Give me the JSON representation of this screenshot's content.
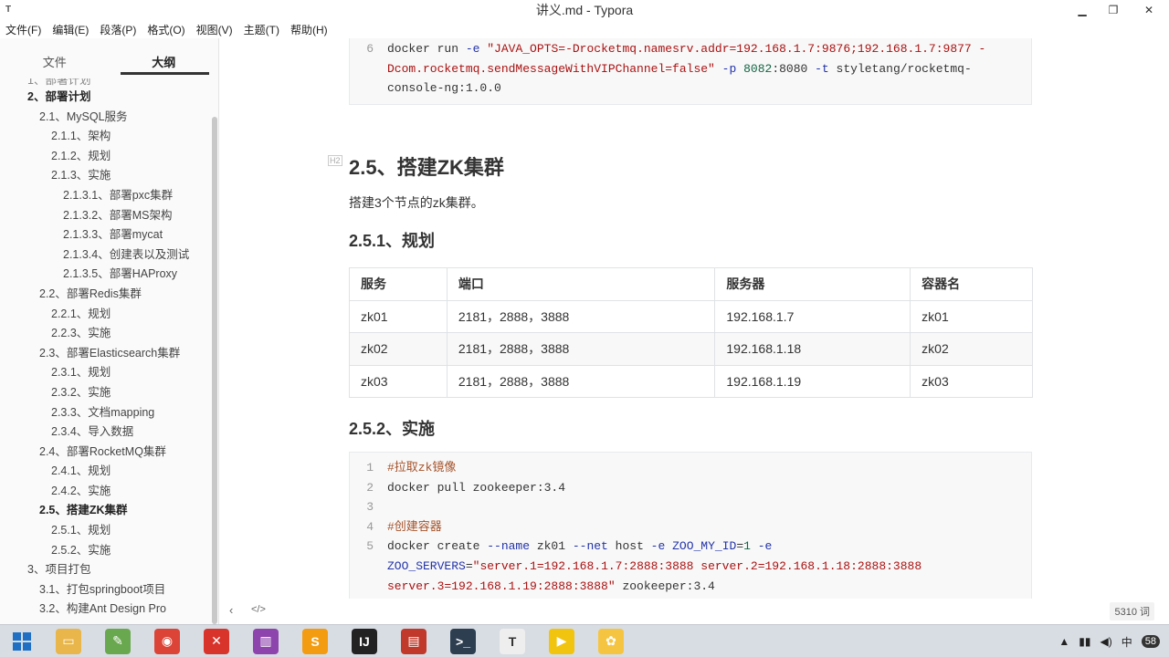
{
  "window": {
    "title": "讲义.md - Typora",
    "app_icon": "T"
  },
  "menu": [
    "文件(F)",
    "编辑(E)",
    "段落(P)",
    "格式(O)",
    "视图(V)",
    "主题(T)",
    "帮助(H)"
  ],
  "sidebar": {
    "tabs": [
      "文件",
      "大纲"
    ],
    "outline": [
      {
        "label": "2、部署计划",
        "level": "l1",
        "bold": true
      },
      {
        "label": "2.1、MySQL服务",
        "level": "l2"
      },
      {
        "label": "2.1.1、架构",
        "level": "l3"
      },
      {
        "label": "2.1.2、规划",
        "level": "l3"
      },
      {
        "label": "2.1.3、实施",
        "level": "l3"
      },
      {
        "label": "2.1.3.1、部署pxc集群",
        "level": "l4"
      },
      {
        "label": "2.1.3.2、部署MS架构",
        "level": "l4"
      },
      {
        "label": "2.1.3.3、部署mycat",
        "level": "l4"
      },
      {
        "label": "2.1.3.4、创建表以及测试",
        "level": "l4"
      },
      {
        "label": "2.1.3.5、部署HAProxy",
        "level": "l4"
      },
      {
        "label": "2.2、部署Redis集群",
        "level": "l2"
      },
      {
        "label": "2.2.1、规划",
        "level": "l3"
      },
      {
        "label": "2.2.3、实施",
        "level": "l3"
      },
      {
        "label": "2.3、部署Elasticsearch集群",
        "level": "l2"
      },
      {
        "label": "2.3.1、规划",
        "level": "l3"
      },
      {
        "label": "2.3.2、实施",
        "level": "l3"
      },
      {
        "label": "2.3.3、文档mapping",
        "level": "l3"
      },
      {
        "label": "2.3.4、导入数据",
        "level": "l3"
      },
      {
        "label": "2.4、部署RocketMQ集群",
        "level": "l2"
      },
      {
        "label": "2.4.1、规划",
        "level": "l3"
      },
      {
        "label": "2.4.2、实施",
        "level": "l3"
      },
      {
        "label": "2.5、搭建ZK集群",
        "level": "l2",
        "bold": true
      },
      {
        "label": "2.5.1、规划",
        "level": "l3"
      },
      {
        "label": "2.5.2、实施",
        "level": "l3"
      },
      {
        "label": "3、项目打包",
        "level": "l1b"
      },
      {
        "label": "3.1、打包springboot项目",
        "level": "l2"
      },
      {
        "label": "3.2、构建Ant Design Pro",
        "level": "l2"
      }
    ]
  },
  "content": {
    "top_code": {
      "line_no": "6",
      "lines": [
        [
          {
            "t": "docker run "
          },
          {
            "t": "-e",
            "c": "c-opt"
          },
          {
            "t": " "
          },
          {
            "t": "\"JAVA_OPTS=-Drocketmq.namesrv.addr=192.168.1.7:9876;192.168.1.7:9877 -",
            "c": "c-str"
          }
        ],
        [
          {
            "t": "Dcom.rocketmq.sendMessageWithVIPChannel=false\"",
            "c": "c-str"
          },
          {
            "t": " "
          },
          {
            "t": "-p",
            "c": "c-opt"
          },
          {
            "t": " "
          },
          {
            "t": "8082",
            "c": "c-num"
          },
          {
            "t": ":8080 "
          },
          {
            "t": "-t",
            "c": "c-opt"
          },
          {
            "t": " styletang/rocketmq-"
          }
        ],
        [
          {
            "t": "console-ng:1.0.0"
          }
        ]
      ]
    },
    "heading": "2.5、搭建ZK集群",
    "heading_mark": "H2",
    "desc": "搭建3个节点的zk集群。",
    "sub1": "2.5.1、规划",
    "table": {
      "headers": [
        "服务",
        "端口",
        "服务器",
        "容器名"
      ],
      "rows": [
        [
          "zk01",
          "2181，2888，3888",
          "192.168.1.7",
          "zk01"
        ],
        [
          "zk02",
          "2181，2888，3888",
          "192.168.1.18",
          "zk02"
        ],
        [
          "zk03",
          "2181，2888，3888",
          "192.168.1.19",
          "zk03"
        ]
      ]
    },
    "sub2": "2.5.2、实施",
    "code": [
      {
        "n": "1",
        "parts": [
          {
            "t": "#拉取zk镜像",
            "c": "c-comment"
          }
        ]
      },
      {
        "n": "2",
        "parts": [
          {
            "t": "docker pull zookeeper:3.4"
          }
        ]
      },
      {
        "n": "3",
        "parts": [
          {
            "t": ""
          }
        ]
      },
      {
        "n": "4",
        "parts": [
          {
            "t": "#创建容器",
            "c": "c-comment"
          }
        ]
      },
      {
        "n": "5",
        "parts": [
          {
            "t": "docker create "
          },
          {
            "t": "--name",
            "c": "c-opt"
          },
          {
            "t": " zk01 "
          },
          {
            "t": "--net",
            "c": "c-opt"
          },
          {
            "t": " host "
          },
          {
            "t": "-e",
            "c": "c-opt"
          },
          {
            "t": " "
          },
          {
            "t": "ZOO_MY_ID",
            "c": "c-opt"
          },
          {
            "t": "="
          },
          {
            "t": "1",
            "c": "c-num"
          },
          {
            "t": " "
          },
          {
            "t": "-e",
            "c": "c-opt"
          }
        ]
      },
      {
        "n": "",
        "parts": [
          {
            "t": "ZOO_SERVERS",
            "c": "c-opt"
          },
          {
            "t": "="
          },
          {
            "t": "\"server.1=192.168.1.7:2888:3888 server.2=192.168.1.18:2888:3888",
            "c": "c-str"
          }
        ]
      },
      {
        "n": "",
        "parts": [
          {
            "t": "server.3=192.168.1.19:2888:3888\"",
            "c": "c-str"
          },
          {
            "t": " zookeeper:3.4"
          }
        ]
      },
      {
        "n": "6",
        "parts": [
          {
            "t": ""
          }
        ]
      }
    ]
  },
  "footer": {
    "word_count": "5310 词"
  },
  "taskbar": {
    "apps": [
      {
        "name": "file-explorer",
        "color": "#e8b64a",
        "glyph": "▭"
      },
      {
        "name": "paint",
        "color": "#6aa84f",
        "glyph": "✎"
      },
      {
        "name": "chrome",
        "color": "#db4437",
        "glyph": "◉"
      },
      {
        "name": "xmind",
        "color": "#d9342b",
        "glyph": "✕"
      },
      {
        "name": "winrar",
        "color": "#8e44ad",
        "glyph": "▥"
      },
      {
        "name": "sublime",
        "color": "#f39c12",
        "glyph": "S"
      },
      {
        "name": "intellij",
        "color": "#222222",
        "glyph": "IJ"
      },
      {
        "name": "notes",
        "color": "#c0392b",
        "glyph": "▤"
      },
      {
        "name": "terminal",
        "color": "#2c3e50",
        "glyph": ">_"
      },
      {
        "name": "typora",
        "color": "#eeeeee",
        "glyph": "T"
      },
      {
        "name": "player",
        "color": "#f1c40f",
        "glyph": "▶"
      },
      {
        "name": "baidu",
        "color": "#f5c542",
        "glyph": "✿"
      }
    ],
    "tray_ime": "中",
    "tray_badge": "58"
  }
}
